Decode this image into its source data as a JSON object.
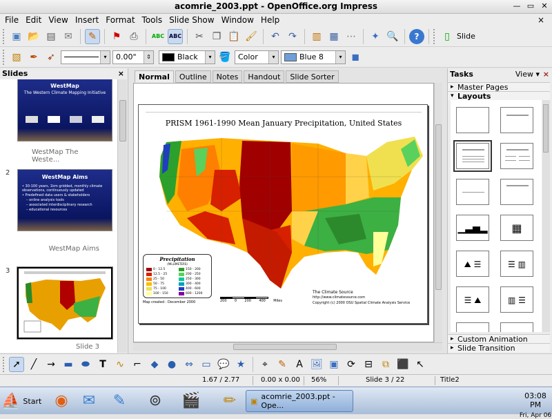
{
  "window": {
    "title": "acomrie_2003.ppt - OpenOffice.org Impress",
    "minimize_icon": "minimize-icon",
    "maximize_icon": "maximize-icon",
    "close_icon": "close-icon"
  },
  "menu": {
    "items": [
      "File",
      "Edit",
      "View",
      "Insert",
      "Format",
      "Tools",
      "Slide Show",
      "Window",
      "Help"
    ],
    "close": "×"
  },
  "toolbar1": {
    "slide_button_label": "Slide"
  },
  "toolbar2": {
    "line_width": "0.00\"",
    "line_color": "Black",
    "area_style": "Color",
    "area_color": "Blue 8",
    "area_color_hex": "#6f9fd9"
  },
  "slides_pane": {
    "title": "Slides",
    "close": "×",
    "slides": [
      {
        "number": "",
        "caption": "WestMap The Weste...",
        "thumb_title": "WestMap",
        "thumb_subtitle": "The Western Climate Mapping Initiative"
      },
      {
        "number": "2",
        "caption": "WestMap Aims",
        "thumb_title": "WestMap Aims",
        "bullets": [
          "• 30-100 years, 1km gridded, monthly climate observations, continuously updated",
          "• Predefined data users & stakeholders",
          "– online analysis tools",
          "– associated interdisciplinary research",
          "– educational resources"
        ]
      },
      {
        "number": "3",
        "caption": "Slide 3"
      }
    ]
  },
  "view_tabs": [
    "Normal",
    "Outline",
    "Notes",
    "Handout",
    "Slide Sorter"
  ],
  "slide": {
    "map_title": "PRISM 1961-1990 Mean January Precipitation, United States",
    "legend_title": "Precipitation",
    "legend_subtitle": "(MILLIMETERS)",
    "legend": [
      {
        "range": "0 - 12.5",
        "color": "#a00000"
      },
      {
        "range": "12.5 - 25",
        "color": "#d62000"
      },
      {
        "range": "25 - 50",
        "color": "#ff7f00"
      },
      {
        "range": "50 - 75",
        "color": "#ffbb00"
      },
      {
        "range": "75 - 100",
        "color": "#f0e050"
      },
      {
        "range": "100 - 150",
        "color": "#ffff99"
      },
      {
        "range": "150 - 200",
        "color": "#2ca02c"
      },
      {
        "range": "200 - 250",
        "color": "#59d15c"
      },
      {
        "range": "250 - 300",
        "color": "#00cc99"
      },
      {
        "range": "300 - 400",
        "color": "#00a0c0"
      },
      {
        "range": "400 - 600",
        "color": "#1f3fbf"
      },
      {
        "range": "600 - 1200",
        "color": "#8000a0"
      }
    ],
    "map_created": "Map created : December 2000",
    "scale_labels": [
      "200",
      "0",
      "200",
      "400",
      "Miles"
    ],
    "source_line1": "The Climate Source",
    "source_line2": "http://www.climatesource.com",
    "source_line3": "Copyright (c) 2000 OSU Spatial Climate Analysis Service"
  },
  "tasks_pane": {
    "title": "Tasks",
    "view_label": "View",
    "close": "×",
    "sections": [
      "Master Pages",
      "Layouts",
      "Custom Animation",
      "Slide Transition"
    ]
  },
  "status": {
    "position": "1.67 / 2.77",
    "size": "0.00 x 0.00",
    "zoom": "56%",
    "slide": "Slide 3 / 22",
    "layout": "Title2"
  },
  "taskbar": {
    "start_label": "Start",
    "task_label": "acomrie_2003.ppt - Ope...",
    "time": "03:08 PM",
    "date": "Fri, Apr 06"
  }
}
